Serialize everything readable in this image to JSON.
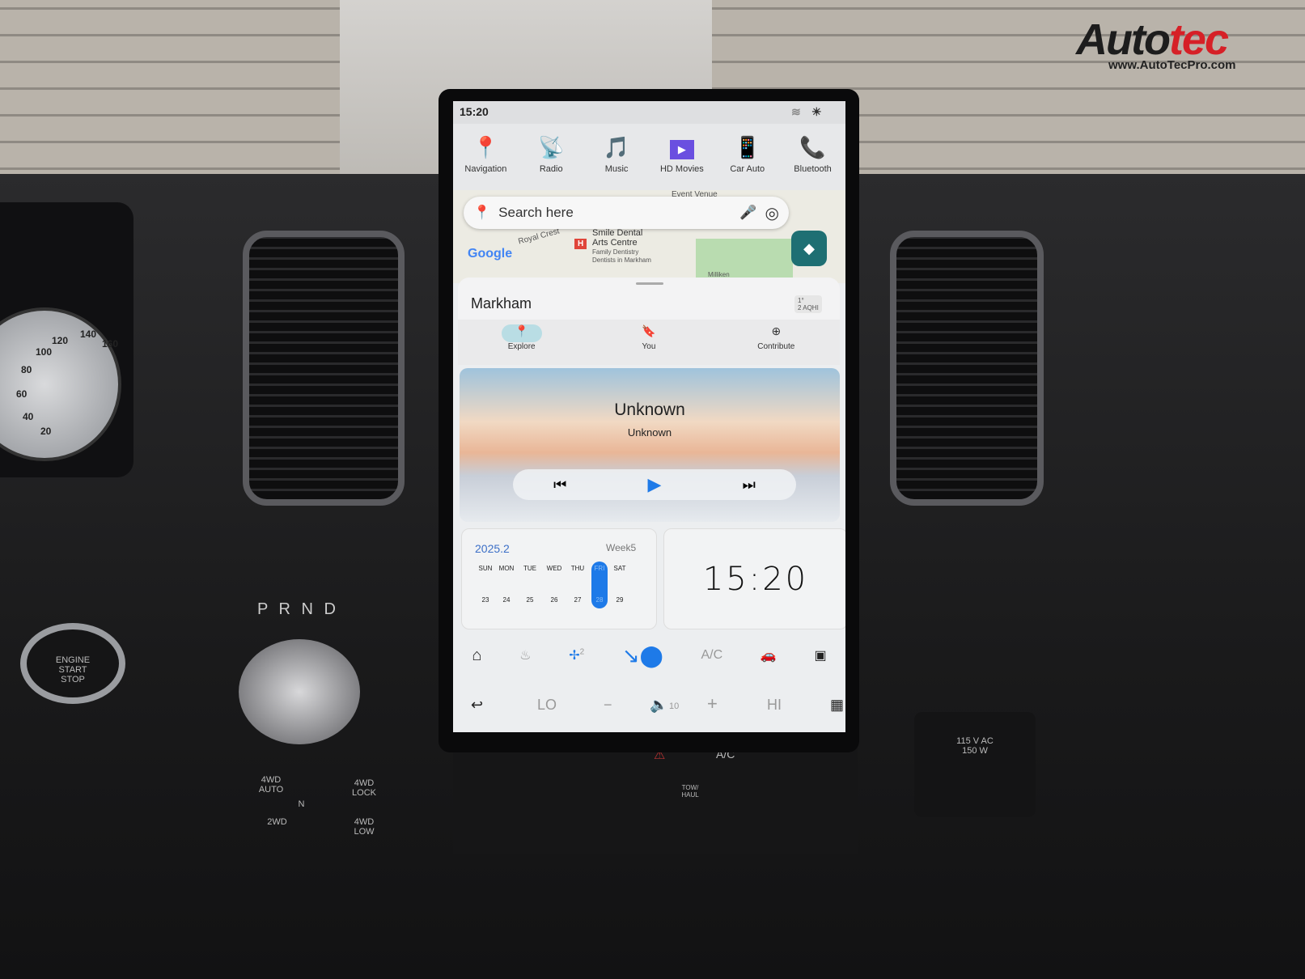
{
  "watermark": {
    "brand": "Autotec",
    "url": "www.AutoTecPro.com"
  },
  "status_bar": {
    "time": "15:20",
    "wifi_icon": "wifi-icon",
    "brightness_icon": "sun-icon"
  },
  "apps": [
    {
      "label": "Navigation",
      "icon": "📍"
    },
    {
      "label": "Radio",
      "icon": "📡"
    },
    {
      "label": "Music",
      "icon": "🎵"
    },
    {
      "label": "HD Movies",
      "icon": "▶"
    },
    {
      "label": "Car Auto",
      "icon": "📱"
    },
    {
      "label": "Bluetooth",
      "icon": "📞"
    }
  ],
  "map": {
    "search_placeholder": "Search here",
    "labels": [
      "Royal Crest",
      "Smile Dental",
      "Arts Centre",
      "Family Dentistry",
      "Dentists in Markham",
      "Event Venue",
      "Milliken"
    ],
    "google_logo": "Google",
    "place": "Markham",
    "weather": {
      "temp": "1°",
      "aqi": "2 AQHI"
    },
    "tabs": [
      {
        "label": "Explore",
        "icon": "⬤"
      },
      {
        "label": "You",
        "icon": "🔖"
      },
      {
        "label": "Contribute",
        "icon": "⊕"
      }
    ]
  },
  "media": {
    "title": "Unknown",
    "artist": "Unknown",
    "prev": "⏮",
    "play": "▶",
    "next": "⏭"
  },
  "calendar": {
    "year_month": "2025.2",
    "week": "Week5",
    "days": [
      {
        "name": "SUN",
        "date": "23"
      },
      {
        "name": "MON",
        "date": "24"
      },
      {
        "name": "TUE",
        "date": "25"
      },
      {
        "name": "WED",
        "date": "26"
      },
      {
        "name": "THU",
        "date": "27"
      },
      {
        "name": "FRI",
        "date": "28",
        "today": true
      },
      {
        "name": "SAT",
        "date": "29"
      }
    ]
  },
  "clock": {
    "time": "15:20"
  },
  "climate": {
    "fan_level": "2",
    "ac_label": "A/C",
    "temp_low": "LO",
    "temp_high": "HI",
    "minus": "−",
    "plus": "+",
    "volume": "10"
  },
  "dashboard": {
    "gear": "P R N D",
    "engine_button": "ENGINE START STOP",
    "outlet": "115 V AC 150 W",
    "fourwd": [
      "4WD AUTO",
      "4WD LOCK",
      "2WD",
      "4WD LOW",
      "N"
    ],
    "tow": "TOW/ HAUL",
    "ac": "A/C",
    "speedo": [
      "20",
      "40",
      "60",
      "80",
      "100",
      "120",
      "140",
      "160"
    ]
  },
  "colors": {
    "accent": "#1e7ae8",
    "calendar_header": "#3c6fc7",
    "nav_button": "#1e6f73"
  }
}
